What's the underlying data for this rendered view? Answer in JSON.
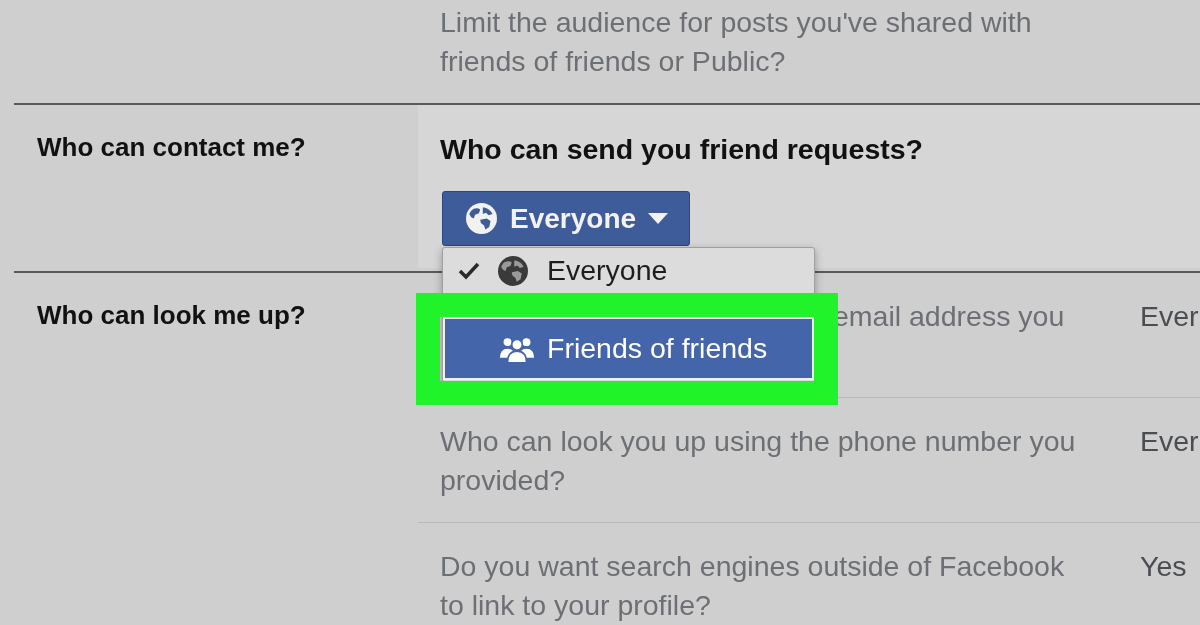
{
  "previous_setting": {
    "description": "Limit the audience for posts you've shared with friends of friends or Public?"
  },
  "contact_section": {
    "label": "Who can contact me?",
    "question": "Who can send you friend requests?",
    "audience_button": {
      "label": "Everyone"
    },
    "dropdown": {
      "items": [
        {
          "label": "Everyone",
          "kind": "public",
          "checked": true,
          "selected": false
        },
        {
          "label": "Friends of friends",
          "kind": "friends",
          "checked": false,
          "selected": true
        }
      ]
    }
  },
  "lookup_section": {
    "label": "Who can look me up?",
    "settings": [
      {
        "question": "email address you",
        "value": "Ever"
      },
      {
        "question": "Who can look you up using the phone number you provided?",
        "value": "Ever"
      },
      {
        "question": "Do you want search engines outside of Facebook to link to your profile?",
        "value": "Yes"
      }
    ]
  }
}
